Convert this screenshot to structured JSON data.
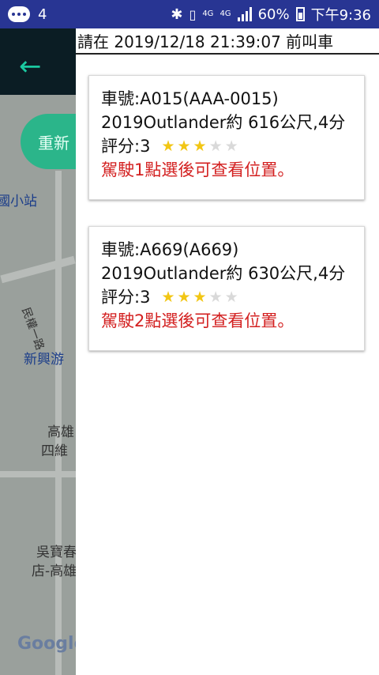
{
  "status_bar": {
    "notification_count": "4",
    "network_a": "4G",
    "network_b": "4G",
    "battery": "60%",
    "time": "下午9:36"
  },
  "map": {
    "refresh_label": "重新",
    "labels": [
      "國小站",
      "民權一路",
      "新興游",
      "高雄",
      "四維",
      "吳寶春",
      "店-高雄"
    ],
    "google": "Google"
  },
  "panel": {
    "title": "請在 2019/12/18 21:39:07 前叫車",
    "cars": [
      {
        "plate_line": "車號:A015(AAA-0015)",
        "info_line": "2019Outlander約 616公尺,4分",
        "rating_label": "評分:3",
        "rating": 3,
        "rating_max": 5,
        "hint": "駕駛1點選後可查看位置。"
      },
      {
        "plate_line": "車號:A669(A669)",
        "info_line": "2019Outlander約 630公尺,4分",
        "rating_label": "評分:3",
        "rating": 3,
        "rating_max": 5,
        "hint": "駕駛2點選後可查看位置。"
      }
    ]
  },
  "colors": {
    "status_bar": "#283593",
    "accent": "#2bb58a",
    "star_on": "#f2c614",
    "hint": "#d32020"
  }
}
